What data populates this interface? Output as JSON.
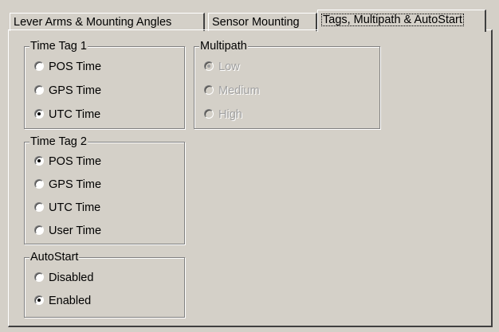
{
  "tabs": [
    {
      "label": "Lever Arms & Mounting Angles",
      "active": false
    },
    {
      "label": "Sensor Mounting",
      "active": false
    },
    {
      "label": "Tags, Multipath & AutoStart",
      "active": true
    }
  ],
  "time_tag1": {
    "title": "Time Tag 1",
    "options": [
      {
        "label": "POS Time",
        "checked": false
      },
      {
        "label": "GPS Time",
        "checked": false
      },
      {
        "label": "UTC Time",
        "checked": true
      }
    ]
  },
  "time_tag2": {
    "title": "Time Tag 2",
    "options": [
      {
        "label": "POS Time",
        "checked": true
      },
      {
        "label": "GPS Time",
        "checked": false
      },
      {
        "label": "UTC Time",
        "checked": false
      },
      {
        "label": "User Time",
        "checked": false
      }
    ]
  },
  "autostart": {
    "title": "AutoStart",
    "options": [
      {
        "label": "Disabled",
        "checked": false
      },
      {
        "label": "Enabled",
        "checked": true
      }
    ]
  },
  "multipath": {
    "title": "Multipath",
    "disabled": true,
    "options": [
      {
        "label": "Low",
        "checked": true
      },
      {
        "label": "Medium",
        "checked": false
      },
      {
        "label": "High",
        "checked": false
      }
    ]
  }
}
